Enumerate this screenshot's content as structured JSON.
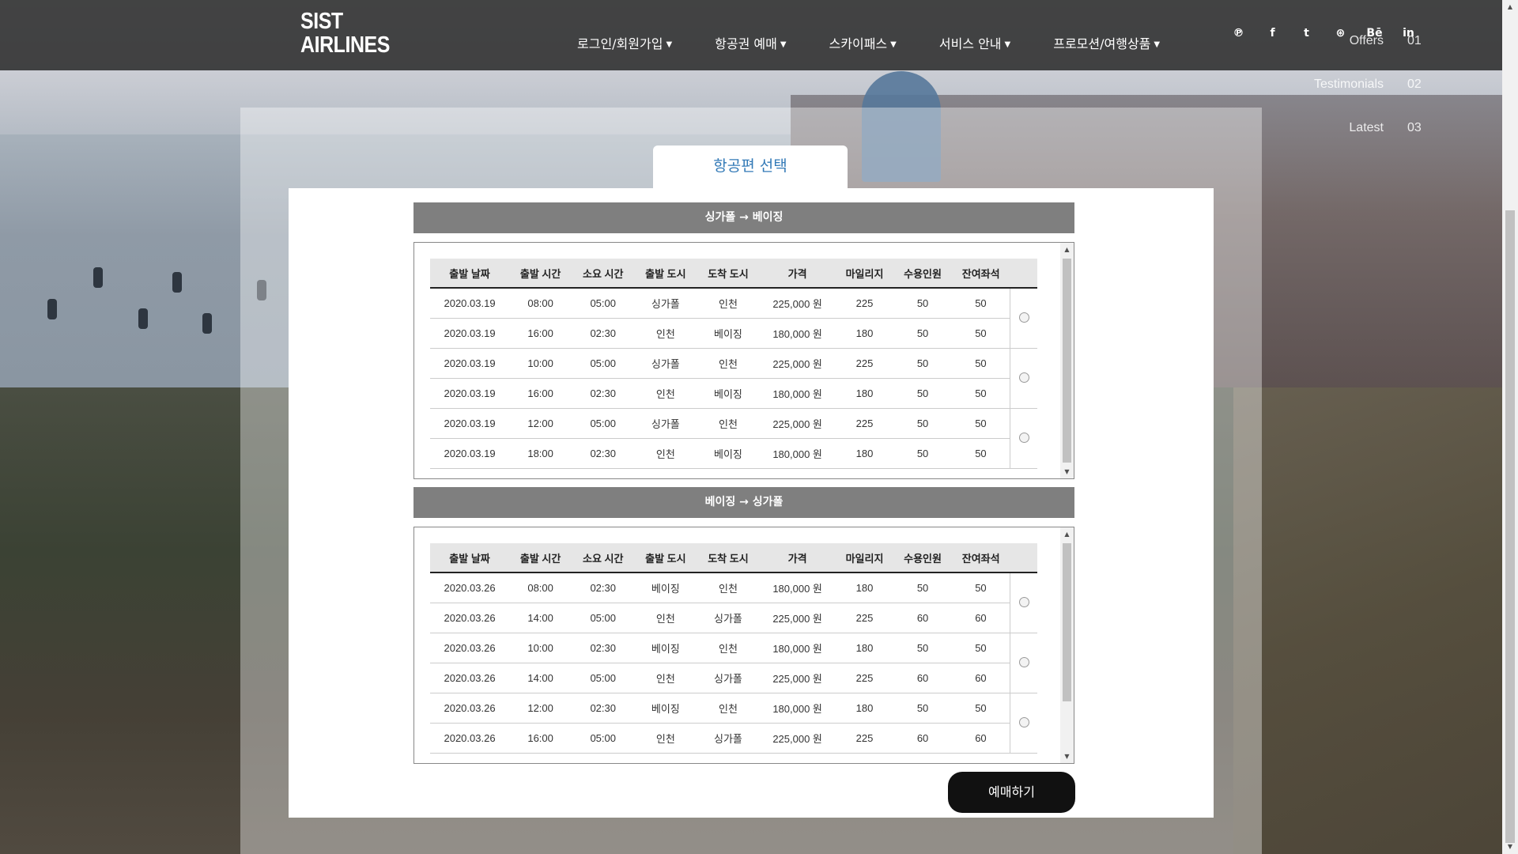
{
  "header": {
    "logo_line1": "SIST",
    "logo_line2": "AIRLINES",
    "nav": [
      {
        "label": "로그인/회원가입"
      },
      {
        "label": "항공권 예매"
      },
      {
        "label": "스카이패스"
      },
      {
        "label": "서비스 안내"
      },
      {
        "label": "프로모션/여행상품"
      }
    ],
    "social": [
      "pinterest-icon",
      "facebook-icon",
      "twitter-icon",
      "dribbble-icon",
      "behance-icon",
      "linkedin-icon"
    ],
    "social_glyphs": [
      "℗",
      "f",
      "t",
      "⊛",
      "Bē",
      "in"
    ],
    "side_menu": [
      {
        "label": "Offers",
        "num": "01"
      },
      {
        "label": "Testimonials",
        "num": "02"
      },
      {
        "label": "Latest",
        "num": "03"
      }
    ]
  },
  "panel": {
    "tab_title": "항공편 선택",
    "book_button": "예매하기"
  },
  "columns": [
    "출발 날짜",
    "출발 시간",
    "소요 시간",
    "출발 도시",
    "도착 도시",
    "가격",
    "마일리지",
    "수용인원",
    "잔여좌석"
  ],
  "outbound": {
    "title": "싱가폴 → 베이징",
    "rows": [
      [
        "2020.03.19",
        "08:00",
        "05:00",
        "싱가폴",
        "인천",
        "225,000 원",
        "225",
        "50",
        "50"
      ],
      [
        "2020.03.19",
        "16:00",
        "02:30",
        "인천",
        "베이징",
        "180,000 원",
        "180",
        "50",
        "50"
      ],
      [
        "2020.03.19",
        "10:00",
        "05:00",
        "싱가폴",
        "인천",
        "225,000 원",
        "225",
        "50",
        "50"
      ],
      [
        "2020.03.19",
        "16:00",
        "02:30",
        "인천",
        "베이징",
        "180,000 원",
        "180",
        "50",
        "50"
      ],
      [
        "2020.03.19",
        "12:00",
        "05:00",
        "싱가폴",
        "인천",
        "225,000 원",
        "225",
        "50",
        "50"
      ],
      [
        "2020.03.19",
        "18:00",
        "02:30",
        "인천",
        "베이징",
        "180,000 원",
        "180",
        "50",
        "50"
      ]
    ]
  },
  "inbound": {
    "title": "베이징 → 싱가폴",
    "rows": [
      [
        "2020.03.26",
        "08:00",
        "02:30",
        "베이징",
        "인천",
        "180,000 원",
        "180",
        "50",
        "50"
      ],
      [
        "2020.03.26",
        "14:00",
        "05:00",
        "인천",
        "싱가폴",
        "225,000 원",
        "225",
        "60",
        "60"
      ],
      [
        "2020.03.26",
        "10:00",
        "02:30",
        "베이징",
        "인천",
        "180,000 원",
        "180",
        "50",
        "50"
      ],
      [
        "2020.03.26",
        "14:00",
        "05:00",
        "인천",
        "싱가폴",
        "225,000 원",
        "225",
        "60",
        "60"
      ],
      [
        "2020.03.26",
        "12:00",
        "02:30",
        "베이징",
        "인천",
        "180,000 원",
        "180",
        "50",
        "50"
      ],
      [
        "2020.03.26",
        "16:00",
        "05:00",
        "인천",
        "싱가폴",
        "225,000 원",
        "225",
        "60",
        "60"
      ]
    ]
  }
}
